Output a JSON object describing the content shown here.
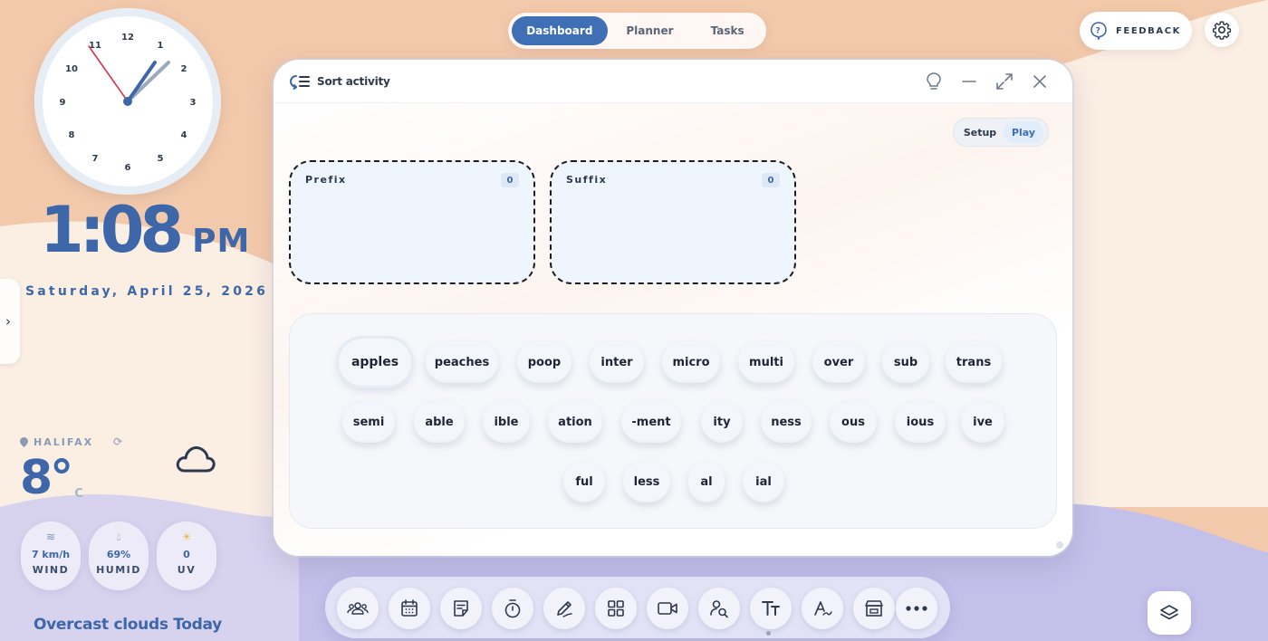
{
  "clock": {
    "numbers": [
      "12",
      "1",
      "2",
      "3",
      "4",
      "5",
      "6",
      "7",
      "8",
      "9",
      "10",
      "11"
    ],
    "time_big": "1:08",
    "ampm": "PM",
    "date": "Saturday, April 25, 2026"
  },
  "weather": {
    "location": "HALIFAX",
    "temperature": "8°",
    "unit": "C",
    "wind_value": "7 km/h",
    "wind_label": "WIND",
    "humidity_value": "69%",
    "humidity_label": "HUMID",
    "uv_value": "0",
    "uv_label": "UV",
    "summary": "Overcast clouds Today"
  },
  "nav": {
    "tabs": [
      {
        "label": "Dashboard",
        "active": true
      },
      {
        "label": "Planner",
        "active": false
      },
      {
        "label": "Tasks",
        "active": false
      }
    ]
  },
  "feedback_label": "FEEDBACK",
  "widget": {
    "title": "Sort activity",
    "mode_setup": "Setup",
    "mode_play": "Play",
    "buckets": [
      {
        "name": "Prefix",
        "count": "0"
      },
      {
        "name": "Suffix",
        "count": "0"
      }
    ],
    "chips": [
      "apples",
      "peaches",
      "poop",
      "inter",
      "micro",
      "multi",
      "over",
      "sub",
      "trans",
      "semi",
      "able",
      "ible",
      "ation",
      "-ment",
      "ity",
      "ness",
      "ous",
      "ious",
      "ive",
      "ful",
      "less",
      "al",
      "ial"
    ]
  },
  "colors": {
    "accent": "#3f6fb5",
    "clock_text": "#3d67a8",
    "bg_peach": "#f5dccb",
    "bg_lavender": "#c3c0ea"
  },
  "dock_icons": [
    "people-icon",
    "calendar-icon",
    "note-icon",
    "timer-icon",
    "draw-icon",
    "grid-icon",
    "video-icon",
    "user-search-icon",
    "text-icon",
    "handwriting-icon",
    "store-icon",
    "more-icon"
  ]
}
